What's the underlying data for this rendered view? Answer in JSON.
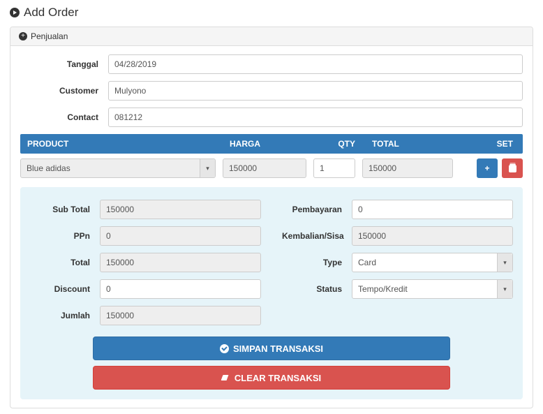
{
  "page": {
    "title": "Add Order"
  },
  "panel": {
    "heading": "Penjualan"
  },
  "form": {
    "labels": {
      "tanggal": "Tanggal",
      "customer": "Customer",
      "contact": "Contact"
    },
    "values": {
      "tanggal": "04/28/2019",
      "customer": "Mulyono",
      "contact": "081212"
    }
  },
  "table": {
    "headers": {
      "product": "PRODUCT",
      "harga": "HARGA",
      "qty": "QTY",
      "total": "TOTAL",
      "set": "SET"
    },
    "rows": [
      {
        "product": "Blue adidas",
        "harga": "150000",
        "qty": "1",
        "total": "150000"
      }
    ]
  },
  "summary": {
    "left": {
      "subtotal": {
        "label": "Sub Total",
        "value": "150000"
      },
      "ppn": {
        "label": "PPn",
        "value": "0"
      },
      "total": {
        "label": "Total",
        "value": "150000"
      },
      "discount": {
        "label": "Discount",
        "value": "0"
      },
      "jumlah": {
        "label": "Jumlah",
        "value": "150000"
      }
    },
    "right": {
      "pembayaran": {
        "label": "Pembayaran",
        "value": "0"
      },
      "kembalian": {
        "label": "Kembalian/Sisa",
        "value": "150000"
      },
      "type": {
        "label": "Type",
        "value": "Card"
      },
      "status": {
        "label": "Status",
        "value": "Tempo/Kredit"
      }
    }
  },
  "buttons": {
    "simpan": "SIMPAN TRANSAKSI",
    "clear": "CLEAR TRANSAKSI"
  }
}
